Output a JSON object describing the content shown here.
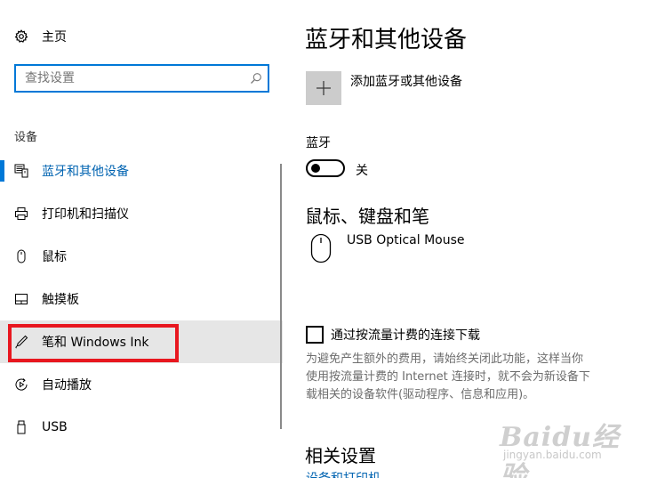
{
  "sidebar": {
    "home_label": "主页",
    "search_placeholder": "查找设置",
    "section_label": "设备",
    "items": [
      {
        "label": "蓝牙和其他设备",
        "icon": "bluetooth-device-icon",
        "active": true
      },
      {
        "label": "打印机和扫描仪",
        "icon": "printer-icon"
      },
      {
        "label": "鼠标",
        "icon": "mouse-icon"
      },
      {
        "label": "触摸板",
        "icon": "touchpad-icon"
      },
      {
        "label": "笔和 Windows Ink",
        "icon": "pen-icon",
        "hovered": true
      },
      {
        "label": "自动播放",
        "icon": "autoplay-icon"
      },
      {
        "label": "USB",
        "icon": "usb-icon"
      }
    ]
  },
  "main": {
    "title": "蓝牙和其他设备",
    "add_device_label": "添加蓝牙或其他设备",
    "bluetooth": {
      "label": "蓝牙",
      "state": "关"
    },
    "mouse_section": {
      "title": "鼠标、键盘和笔",
      "device_name": "USB Optical Mouse"
    },
    "metered": {
      "label": "通过按流量计费的连接下载",
      "description_lines": [
        "为避免产生额外的费用，请始终关闭此功能，这样当你",
        "使用按流量计费的 Internet 连接时，就不会为新设备下",
        "载相关的设备软件(驱动程序、信息和应用)。"
      ]
    },
    "related": {
      "title": "相关设置",
      "link": "设备和打印机"
    }
  },
  "watermark": {
    "brand": "Baidu经验",
    "sub": "jingyan.baidu.com"
  },
  "colors": {
    "accent": "#0078d7",
    "link": "#0063b1",
    "hover": "#e6e6e6",
    "highlight": "#e8171f",
    "tile": "#cccccc"
  }
}
